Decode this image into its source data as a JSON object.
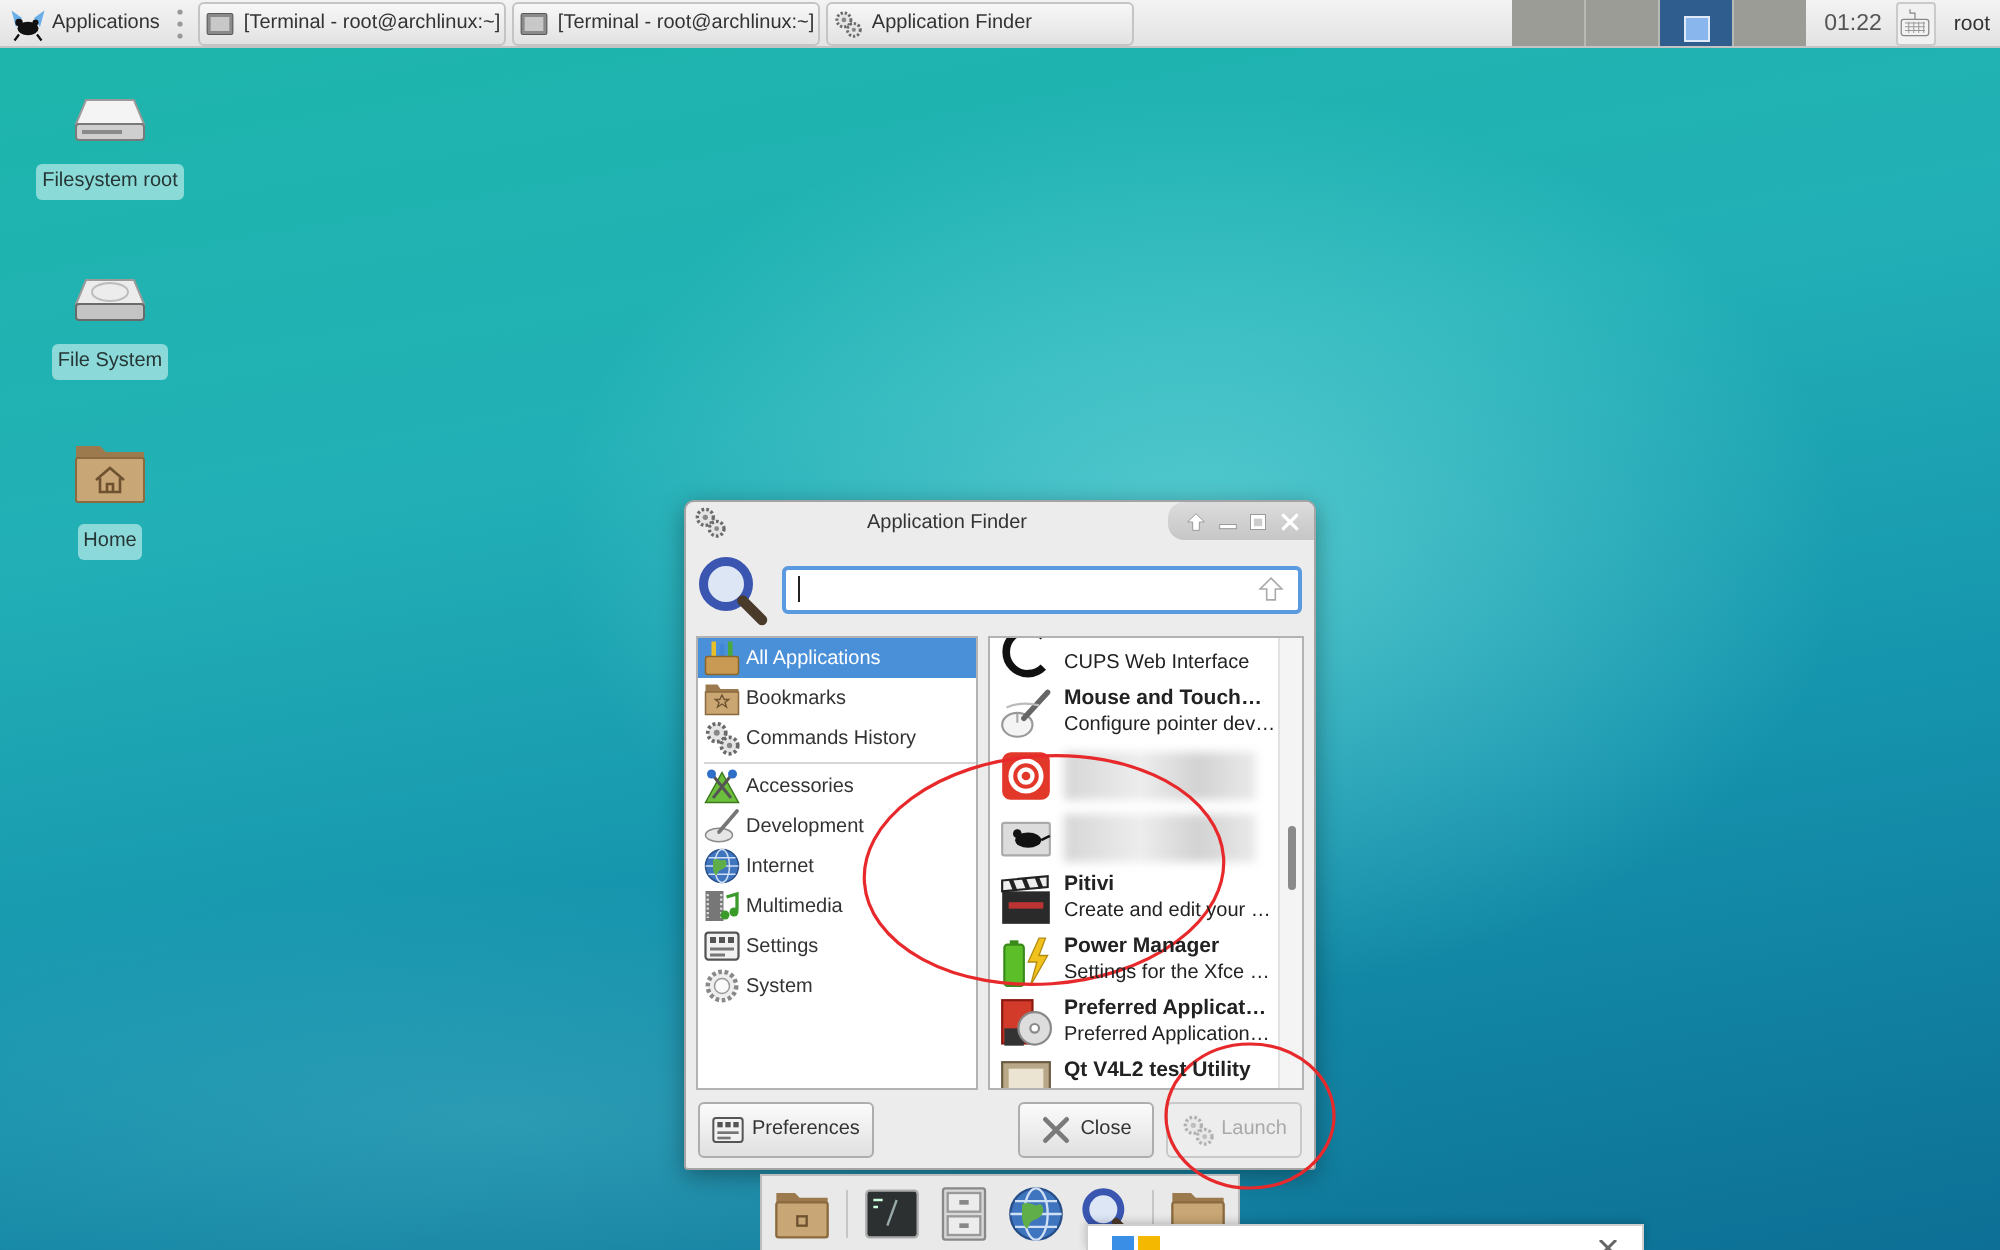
{
  "top_panel": {
    "applications_menu": {
      "label": "Applications"
    },
    "tasks": [
      {
        "label": "[Terminal - root@archlinux:~]",
        "kind": "terminal"
      },
      {
        "label": "[Terminal - root@archlinux:~]",
        "kind": "terminal"
      },
      {
        "label": "Application Finder",
        "kind": "finder"
      }
    ],
    "workspaces": [
      {
        "selected": false,
        "has_window": false
      },
      {
        "selected": false,
        "has_window": false
      },
      {
        "selected": true,
        "has_window": true
      },
      {
        "selected": false,
        "has_window": false
      }
    ],
    "clock": "01:22",
    "user": "root"
  },
  "desktop_icons": [
    {
      "label": "Filesystem root",
      "kind": "drive"
    },
    {
      "label": "File System",
      "kind": "disk"
    },
    {
      "label": "Home",
      "kind": "home"
    }
  ],
  "app_finder": {
    "title": "Application Finder",
    "category_groups": [
      {
        "items": [
          {
            "label": "All Applications",
            "kind": "all",
            "selected": true
          },
          {
            "label": "Bookmarks",
            "kind": "bookmarks",
            "selected": false
          },
          {
            "label": "Commands History",
            "kind": "history",
            "selected": false
          }
        ]
      },
      {
        "items": [
          {
            "label": "Accessories",
            "kind": "accessories",
            "selected": false
          },
          {
            "label": "Development",
            "kind": "development",
            "selected": false
          },
          {
            "label": "Internet",
            "kind": "internet",
            "selected": false
          },
          {
            "label": "Multimedia",
            "kind": "multimedia",
            "selected": false
          },
          {
            "label": "Settings",
            "kind": "settings",
            "selected": false
          },
          {
            "label": "System",
            "kind": "system",
            "selected": false
          }
        ]
      }
    ],
    "applications": [
      {
        "description": "CUPS Web Interface",
        "kind": "printing",
        "blurred": false,
        "selected": false
      },
      {
        "name": "Mouse and Touch…",
        "description": "Configure pointer dev…",
        "kind": "mouse",
        "blurred": false,
        "selected": false
      },
      {
        "kind": "swirl",
        "blurred": true,
        "selected": false
      },
      {
        "kind": "rodent",
        "blurred": true,
        "selected": false
      },
      {
        "name": "Pitivi",
        "description": "Create and edit your …",
        "kind": "clapper",
        "blurred": false,
        "selected": false
      },
      {
        "name": "Power Manager",
        "description": "Settings for the Xfce …",
        "kind": "power",
        "blurred": false,
        "selected": false
      },
      {
        "name": "Preferred Applicat…",
        "description": "Preferred Application…",
        "kind": "preferred",
        "blurred": false,
        "selected": false
      },
      {
        "name": "Qt V4L2 test Utility",
        "kind": "qt",
        "blurred": false,
        "selected": false
      }
    ],
    "buttons": [
      {
        "label": "Preferences",
        "kind": "preferences",
        "disabled": false
      },
      {
        "label": "Close",
        "kind": "close",
        "disabled": false
      },
      {
        "label": "Launch",
        "kind": "launch",
        "disabled": true
      }
    ]
  },
  "dock": {
    "groups": [
      {
        "launchers": [
          {
            "kind": "documents"
          }
        ]
      },
      {
        "launchers": [
          {
            "kind": "terminal"
          },
          {
            "kind": "cabinet"
          },
          {
            "kind": "browser"
          },
          {
            "kind": "search"
          }
        ]
      },
      {
        "launchers": [
          {
            "kind": "folder"
          }
        ]
      }
    ]
  },
  "notification": {
    "shown": true
  },
  "annotations": [
    {
      "kind": "ellipse"
    },
    {
      "kind": "ellipse"
    }
  ]
}
